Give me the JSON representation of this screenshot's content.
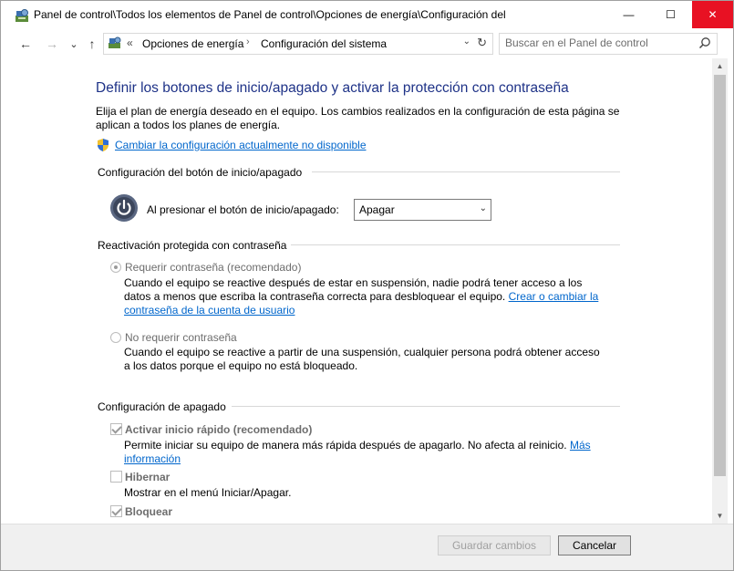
{
  "window": {
    "title": "Panel de control\\Todos los elementos de Panel de control\\Opciones de energía\\Configuración del",
    "minimize_glyph": "—",
    "maximize_glyph": "☐",
    "close_glyph": "✕"
  },
  "nav": {
    "back_glyph": "←",
    "forward_glyph": "→",
    "recent_glyph": "⌄",
    "up_glyph": "↑"
  },
  "address": {
    "overflow": "«",
    "crumbs": [
      "Opciones de energía",
      "Configuración del sistema"
    ],
    "crumb_sep": "›",
    "dropdown_glyph": "⌄",
    "refresh_glyph": "↻"
  },
  "search": {
    "placeholder": "Buscar en el Panel de control"
  },
  "page": {
    "heading": "Definir los botones de inicio/apagado y activar la protección con contraseña",
    "intro": "Elija el plan de energía deseado en el equipo. Los cambios realizados en la configuración de esta página se aplican a todos los planes de energía.",
    "change_link": "Cambiar la configuración actualmente no disponible"
  },
  "power_button": {
    "section_title": "Configuración del botón de inicio/apagado",
    "label": "Al presionar el botón de inicio/apagado:",
    "selected": "Apagar",
    "arrow_glyph": "⌄"
  },
  "wakeup": {
    "section_title": "Reactivación protegida con contraseña",
    "require": {
      "label": "Requerir contraseña (recomendado)",
      "checked": true,
      "desc": "Cuando el equipo se reactive después de estar en suspensión, nadie podrá tener acceso a los datos a menos que escriba la contraseña correcta para desbloquear el equipo.",
      "link": "Crear o cambiar la contraseña de la cuenta de usuario"
    },
    "no_require": {
      "label": "No requerir contraseña",
      "checked": false,
      "desc": "Cuando el equipo se reactive a partir de una suspensión, cualquier persona podrá obtener acceso a los datos porque el equipo no está bloqueado."
    }
  },
  "shutdown": {
    "section_title": "Configuración de apagado",
    "fast_startup": {
      "label": "Activar inicio rápido (recomendado)",
      "checked": true,
      "desc": "Permite iniciar su equipo de manera más rápida después de apagarlo. No afecta al reinicio.",
      "link": "Más información"
    },
    "hibernate": {
      "label": "Hibernar",
      "checked": false,
      "desc": "Mostrar en el menú Iniciar/Apagar."
    },
    "lock": {
      "label": "Bloquear",
      "checked": true
    }
  },
  "scrollbar": {
    "up_glyph": "▲",
    "down_glyph": "▼"
  },
  "footer": {
    "save_label": "Guardar cambios",
    "cancel_label": "Cancelar"
  },
  "colors": {
    "heading": "#1e3287",
    "link": "#0066cc",
    "close_button": "#e81123"
  }
}
